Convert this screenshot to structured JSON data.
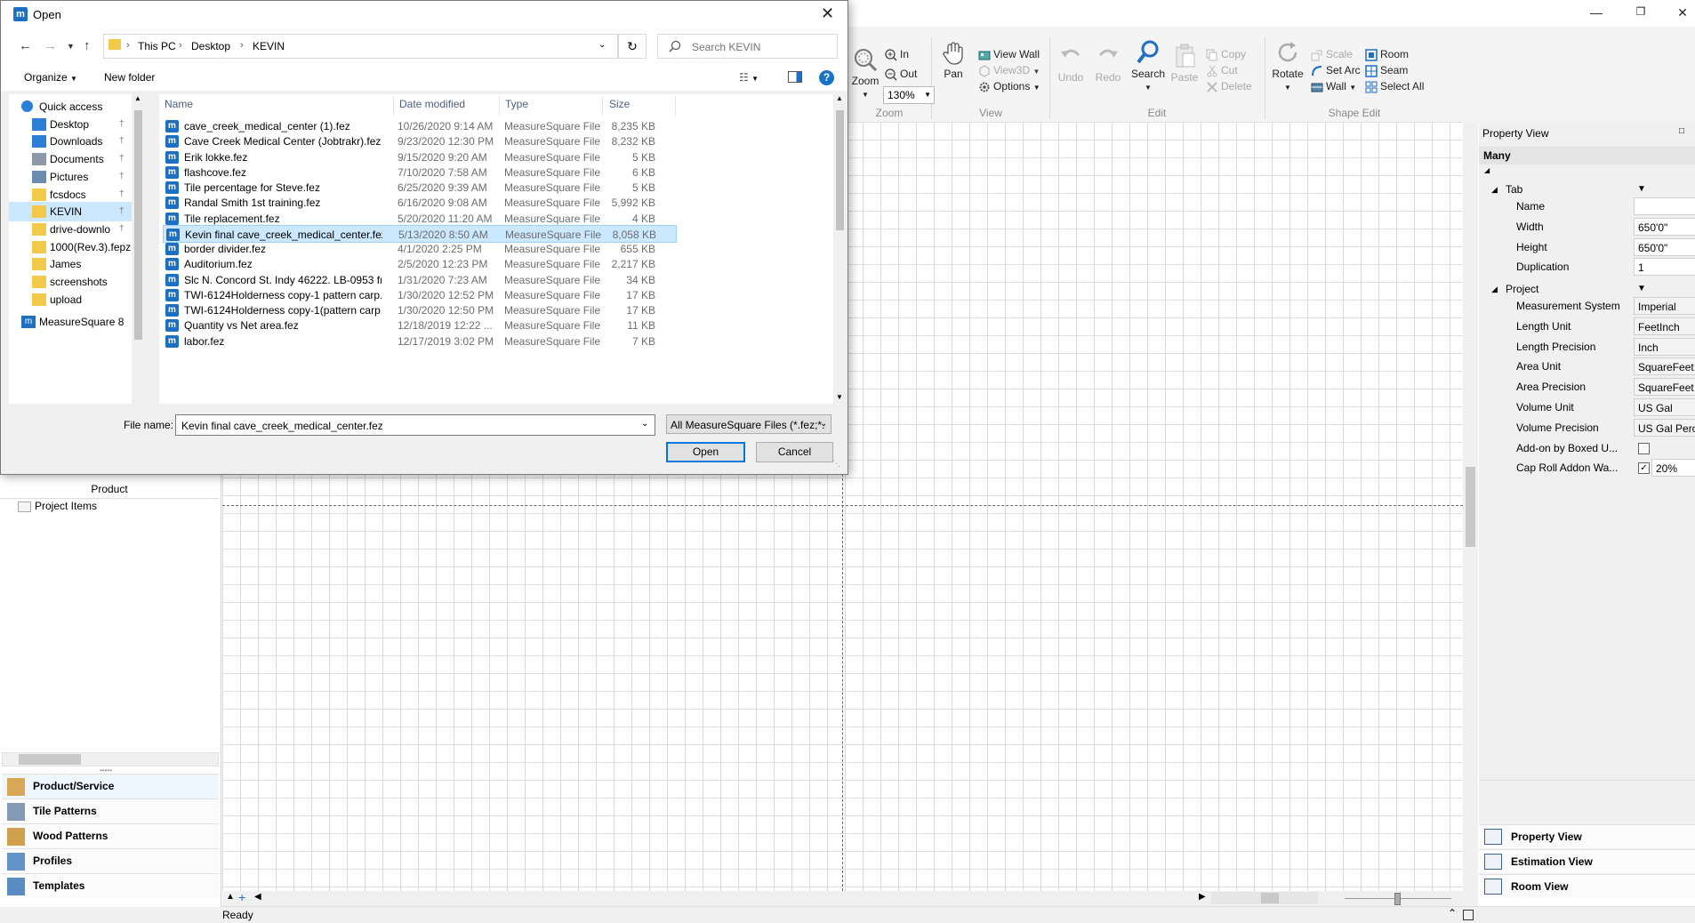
{
  "dialog": {
    "title": "Open",
    "address": [
      "This PC",
      "Desktop",
      "KEVIN"
    ],
    "search_placeholder": "Search KEVIN",
    "toolbar": {
      "organize": "Organize",
      "new_folder": "New folder"
    },
    "nav_items": [
      {
        "label": "Quick access",
        "icon": "star-icon",
        "pinned": false
      },
      {
        "label": "Desktop",
        "icon": "desktop-icon",
        "pinned": true
      },
      {
        "label": "Downloads",
        "icon": "download-icon",
        "pinned": true
      },
      {
        "label": "Documents",
        "icon": "documents-icon",
        "pinned": true
      },
      {
        "label": "Pictures",
        "icon": "pictures-icon",
        "pinned": true
      },
      {
        "label": "fcsdocs",
        "icon": "folder-icon",
        "pinned": true
      },
      {
        "label": "KEVIN",
        "icon": "folder-icon",
        "pinned": true,
        "selected": true
      },
      {
        "label": "drive-downlo",
        "icon": "folder-icon",
        "pinned": true
      },
      {
        "label": "1000(Rev.3).fepz",
        "icon": "folder-icon",
        "pinned": false
      },
      {
        "label": "James",
        "icon": "folder-icon",
        "pinned": false
      },
      {
        "label": "screenshots",
        "icon": "folder-icon",
        "pinned": false
      },
      {
        "label": "upload",
        "icon": "folder-icon",
        "pinned": false
      },
      {
        "label": "MeasureSquare 8",
        "icon": "measuresquare-icon",
        "pinned": false
      }
    ],
    "columns": [
      "Name",
      "Date modified",
      "Type",
      "Size"
    ],
    "files": [
      {
        "name": "cave_creek_medical_center (1).fez",
        "date": "10/26/2020 9:14 AM",
        "type": "MeasureSquare File",
        "size": "8,235 KB"
      },
      {
        "name": "Cave Creek Medical Center (Jobtrakr).fez",
        "date": "9/23/2020 12:30 PM",
        "type": "MeasureSquare File",
        "size": "8,232 KB"
      },
      {
        "name": "Erik lokke.fez",
        "date": "9/15/2020 9:20 AM",
        "type": "MeasureSquare File",
        "size": "5 KB"
      },
      {
        "name": "flashcove.fez",
        "date": "7/10/2020 7:58 AM",
        "type": "MeasureSquare File",
        "size": "6 KB"
      },
      {
        "name": "Tile percentage for Steve.fez",
        "date": "6/25/2020 9:39 AM",
        "type": "MeasureSquare File",
        "size": "5 KB"
      },
      {
        "name": "Randal Smith 1st training.fez",
        "date": "6/16/2020 9:08 AM",
        "type": "MeasureSquare File",
        "size": "5,992 KB"
      },
      {
        "name": "Tile replacement.fez",
        "date": "5/20/2020 11:20 AM",
        "type": "MeasureSquare File",
        "size": "4 KB"
      },
      {
        "name": "Kevin final cave_creek_medical_center.fez",
        "date": "5/13/2020 8:50 AM",
        "type": "MeasureSquare File",
        "size": "8,058 KB",
        "selected": true
      },
      {
        "name": "border divider.fez",
        "date": "4/1/2020 2:25 PM",
        "type": "MeasureSquare File",
        "size": "655 KB"
      },
      {
        "name": "Auditorium.fez",
        "date": "2/5/2020 12:23 PM",
        "type": "MeasureSquare File",
        "size": "2,217 KB"
      },
      {
        "name": "Slc N. Concord St. Indy 46222. LB-0953 fr...",
        "date": "1/31/2020 7:23 AM",
        "type": "MeasureSquare File",
        "size": "34 KB"
      },
      {
        "name": "TWI-6124Holderness copy-1 pattern carp...",
        "date": "1/30/2020 12:52 PM",
        "type": "MeasureSquare File",
        "size": "17 KB"
      },
      {
        "name": "TWI-6124Holderness copy-1(pattern carp...",
        "date": "1/30/2020 12:50 PM",
        "type": "MeasureSquare File",
        "size": "17 KB"
      },
      {
        "name": "Quantity vs Net area.fez",
        "date": "12/18/2019 12:22 ...",
        "type": "MeasureSquare File",
        "size": "11 KB"
      },
      {
        "name": "labor.fez",
        "date": "12/17/2019 3:02 PM",
        "type": "MeasureSquare File",
        "size": "7 KB"
      }
    ],
    "file_name_label": "File name:",
    "file_name_value": "Kevin final cave_creek_medical_center.fez",
    "filter": "All MeasureSquare Files (*.fez;*.",
    "open_label": "Open",
    "cancel_label": "Cancel"
  },
  "ribbon": {
    "zoom": {
      "label": "Zoom",
      "in": "In",
      "out": "Out",
      "level": "130%",
      "group": "Zoom"
    },
    "view": {
      "pan": "Pan",
      "view_wall": "View Wall",
      "view3d": "View3D",
      "options": "Options",
      "group": "View"
    },
    "edit": {
      "undo": "Undo",
      "redo": "Redo",
      "search": "Search",
      "paste": "Paste",
      "copy": "Copy",
      "cut": "Cut",
      "delete": "Delete",
      "group": "Edit"
    },
    "shape": {
      "rotate": "Rotate",
      "scale": "Scale",
      "set_arc": "Set Arc",
      "wall": "Wall",
      "room": "Room",
      "seam": "Seam",
      "select_all": "Select All",
      "group": "Shape Edit"
    }
  },
  "left_panel": {
    "header": "Product",
    "tree_item": "Project Items",
    "nav": [
      {
        "label": "Product/Service",
        "icon": "product-service-icon",
        "active": true
      },
      {
        "label": "Tile Patterns",
        "icon": "tile-patterns-icon"
      },
      {
        "label": "Wood Patterns",
        "icon": "wood-patterns-icon"
      },
      {
        "label": "Profiles",
        "icon": "profiles-icon"
      },
      {
        "label": "Templates",
        "icon": "templates-icon"
      }
    ]
  },
  "property_view": {
    "title": "Property View",
    "selection": "Many",
    "tab_category": "Tab",
    "tab_rows": [
      {
        "key": "Name",
        "value": ""
      },
      {
        "key": "Width",
        "value": "650'0\""
      },
      {
        "key": "Height",
        "value": "650'0\""
      },
      {
        "key": "Duplication",
        "value": "1"
      }
    ],
    "project_category": "Project",
    "project_rows": [
      {
        "key": "Measurement System",
        "value": "Imperial"
      },
      {
        "key": "Length Unit",
        "value": "FeetInch"
      },
      {
        "key": "Length Precision",
        "value": "Inch"
      },
      {
        "key": "Area Unit",
        "value": "SquareFeet"
      },
      {
        "key": "Area Precision",
        "value": "SquareFeet I"
      },
      {
        "key": "Volume Unit",
        "value": "US Gal"
      },
      {
        "key": "Volume Precision",
        "value": "US Gal Perce"
      },
      {
        "key": "Add-on by Boxed U...",
        "value": ""
      },
      {
        "key": "Cap Roll Addon Wa...",
        "value": "20%"
      }
    ],
    "bottom_buttons": [
      {
        "label": "Property View",
        "icon": "property-view-icon"
      },
      {
        "label": "Estimation View",
        "icon": "estimation-view-icon"
      },
      {
        "label": "Room View",
        "icon": "room-view-icon"
      }
    ]
  },
  "status": "Ready"
}
